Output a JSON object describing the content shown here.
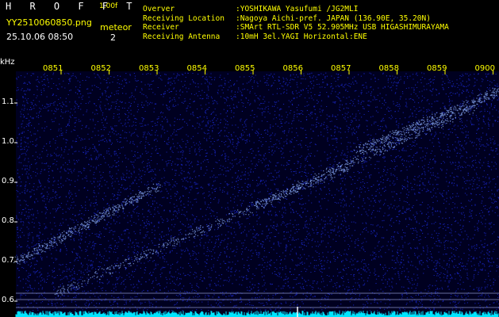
{
  "header": {
    "app_title": "H R O F F T",
    "version": "1.00f",
    "filename": "YY2510060850.png",
    "datetime": "25.10.06 08:50",
    "meteor_label": "meteor",
    "meteor_count": "2"
  },
  "info": [
    {
      "key": "Overver",
      "value": ":YOSHIKAWA Yasufumi /JG2MLI"
    },
    {
      "key": "Receiving Location",
      "value": ":Nagoya Aichi-pref. JAPAN (136.90E, 35.20N)"
    },
    {
      "key": "Receiver",
      "value": ":SMArt RTL-SDR V5 52.905MHz USB HIGASHIMURAYAMA"
    },
    {
      "key": "Receiving Antenna",
      "value": ":10mH 3el.YAGI Horizontal:ENE"
    }
  ],
  "chart_data": {
    "type": "heatmap",
    "ylabel": "kHz",
    "y_ticks": [
      "1.1",
      "1.0",
      "0.9",
      "0.8",
      "0.7",
      "0.6"
    ],
    "x_ticks": [
      "0851",
      "0852",
      "0853",
      "0854",
      "0855",
      "0856",
      "0857",
      "0858",
      "0859",
      "0900"
    ],
    "colors": {
      "background": "#000033",
      "noise": "#1d2bd8",
      "signal": "#8fb2ff",
      "baseline": "#00e5ff",
      "axis": "#ffffff",
      "tick_label": "#ffff00"
    }
  }
}
